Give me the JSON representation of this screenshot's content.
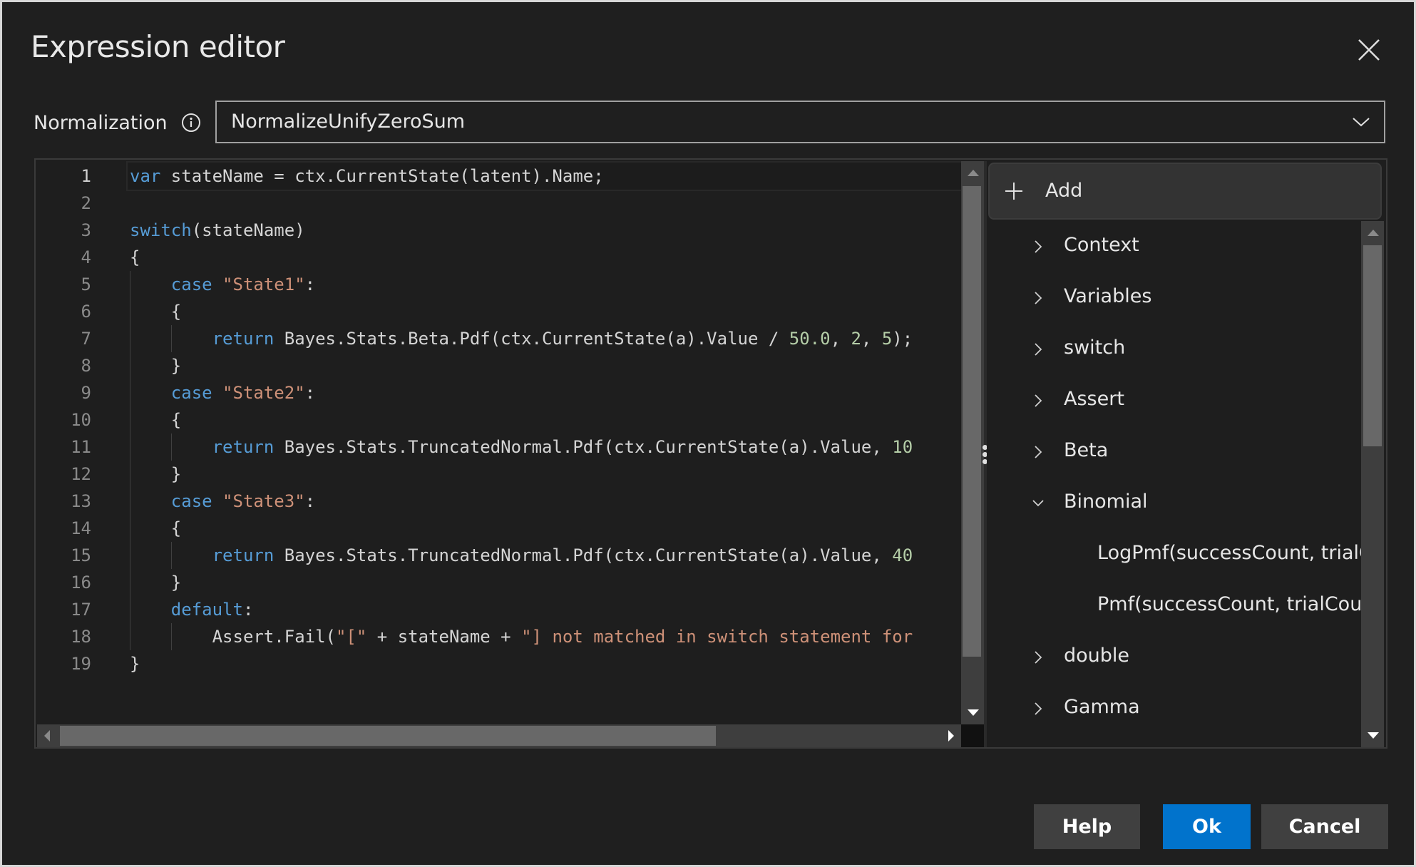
{
  "dialog": {
    "title": "Expression editor",
    "close_icon": "close-icon"
  },
  "normalization": {
    "label": "Normalization",
    "info_icon": "info-icon",
    "selected": "NormalizeUnifyZeroSum",
    "dropdown_icon": "chevron-down-icon"
  },
  "editor": {
    "current_line": 1,
    "lines": [
      {
        "n": "1",
        "tokens": [
          {
            "t": "var",
            "c": "kw"
          },
          {
            "t": " stateName = ctx.CurrentState(latent).Name;"
          }
        ]
      },
      {
        "n": "2",
        "tokens": []
      },
      {
        "n": "3",
        "tokens": [
          {
            "t": "switch",
            "c": "kw"
          },
          {
            "t": "(stateName)"
          }
        ]
      },
      {
        "n": "4",
        "tokens": [
          {
            "t": "{"
          }
        ]
      },
      {
        "n": "5",
        "tokens": [
          {
            "t": "    "
          },
          {
            "t": "case",
            "c": "kw"
          },
          {
            "t": " "
          },
          {
            "t": "\"State1\"",
            "c": "str"
          },
          {
            "t": ":"
          }
        ]
      },
      {
        "n": "6",
        "tokens": [
          {
            "t": "    {"
          }
        ]
      },
      {
        "n": "7",
        "tokens": [
          {
            "t": "        "
          },
          {
            "t": "return",
            "c": "kw"
          },
          {
            "t": " Bayes.Stats.Beta.Pdf(ctx.CurrentState(a).Value / "
          },
          {
            "t": "50.0",
            "c": "num"
          },
          {
            "t": ", "
          },
          {
            "t": "2",
            "c": "num"
          },
          {
            "t": ", "
          },
          {
            "t": "5",
            "c": "num"
          },
          {
            "t": ");"
          }
        ]
      },
      {
        "n": "8",
        "tokens": [
          {
            "t": "    }"
          }
        ]
      },
      {
        "n": "9",
        "tokens": [
          {
            "t": "    "
          },
          {
            "t": "case",
            "c": "kw"
          },
          {
            "t": " "
          },
          {
            "t": "\"State2\"",
            "c": "str"
          },
          {
            "t": ":"
          }
        ]
      },
      {
        "n": "10",
        "tokens": [
          {
            "t": "    {"
          }
        ]
      },
      {
        "n": "11",
        "tokens": [
          {
            "t": "        "
          },
          {
            "t": "return",
            "c": "kw"
          },
          {
            "t": " Bayes.Stats.TruncatedNormal.Pdf(ctx.CurrentState(a).Value, "
          },
          {
            "t": "10",
            "c": "num"
          }
        ]
      },
      {
        "n": "12",
        "tokens": [
          {
            "t": "    }"
          }
        ]
      },
      {
        "n": "13",
        "tokens": [
          {
            "t": "    "
          },
          {
            "t": "case",
            "c": "kw"
          },
          {
            "t": " "
          },
          {
            "t": "\"State3\"",
            "c": "str"
          },
          {
            "t": ":"
          }
        ]
      },
      {
        "n": "14",
        "tokens": [
          {
            "t": "    {"
          }
        ]
      },
      {
        "n": "15",
        "tokens": [
          {
            "t": "        "
          },
          {
            "t": "return",
            "c": "kw"
          },
          {
            "t": " Bayes.Stats.TruncatedNormal.Pdf(ctx.CurrentState(a).Value, "
          },
          {
            "t": "40",
            "c": "num"
          }
        ]
      },
      {
        "n": "16",
        "tokens": [
          {
            "t": "    }"
          }
        ]
      },
      {
        "n": "17",
        "tokens": [
          {
            "t": "    "
          },
          {
            "t": "default",
            "c": "kw"
          },
          {
            "t": ":"
          }
        ]
      },
      {
        "n": "18",
        "tokens": [
          {
            "t": "        Assert.Fail("
          },
          {
            "t": "\"[\"",
            "c": "str"
          },
          {
            "t": " + stateName + "
          },
          {
            "t": "\"] not matched in switch statement for",
            "c": "str"
          }
        ]
      },
      {
        "n": "19",
        "tokens": [
          {
            "t": "}"
          }
        ]
      }
    ],
    "vertical_scroll_fraction_visible": 0.88,
    "horizontal_scroll_fraction_visible": 0.73
  },
  "panel": {
    "add_label": "Add",
    "add_icon": "plus-icon",
    "items": [
      {
        "label": "Context",
        "expanded": false,
        "child": false
      },
      {
        "label": "Variables",
        "expanded": false,
        "child": false
      },
      {
        "label": "switch",
        "expanded": false,
        "child": false
      },
      {
        "label": "Assert",
        "expanded": false,
        "child": false
      },
      {
        "label": "Beta",
        "expanded": false,
        "child": false
      },
      {
        "label": "Binomial",
        "expanded": true,
        "child": false
      },
      {
        "label": "LogPmf(successCount, trialCount, probability)",
        "child": true
      },
      {
        "label": "Pmf(successCount, trialCount, probability)",
        "child": true
      },
      {
        "label": "double",
        "expanded": false,
        "child": false
      },
      {
        "label": "Gamma",
        "expanded": false,
        "child": false
      }
    ]
  },
  "buttons": {
    "help": "Help",
    "ok": "Ok",
    "cancel": "Cancel"
  },
  "colors": {
    "accent": "#0173cc",
    "keyword": "#569cd6",
    "string": "#ce9178",
    "number": "#b5cea8",
    "background": "#1f1f1f"
  }
}
